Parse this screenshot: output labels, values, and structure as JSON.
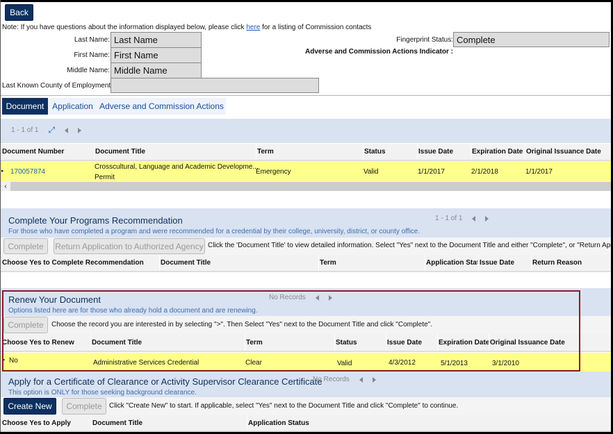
{
  "back_label": "Back",
  "note": {
    "prefix": "Note: If you have questions about the information displayed below, please click ",
    "link": "here",
    "suffix": " for a listing of Commission contacts"
  },
  "fields": {
    "last_name": {
      "label": "Last Name:",
      "value": "Last Name"
    },
    "first_name": {
      "label": "First Name:",
      "value": "First Name"
    },
    "middle_name": {
      "label": "Middle Name:",
      "value": "Middle Name"
    },
    "county": {
      "label": "Last Known County of Employment:",
      "value": ""
    },
    "fingerprint": {
      "label": "Fingerprint Status:",
      "value": "Complete"
    },
    "adverse_indicator": {
      "label": "Adverse and Commission Actions Indicator :"
    }
  },
  "tabs": [
    {
      "label": "Document",
      "active": true
    },
    {
      "label": "Application"
    },
    {
      "label": "Adverse and Commission Actions"
    }
  ],
  "documents": {
    "pager": "1 - 1 of 1",
    "columns": [
      "Document Number",
      "Document Title",
      "Term",
      "Status",
      "Issue Date",
      "Expiration Date",
      "Original Issuance Date"
    ],
    "rows": [
      {
        "number": "170057874",
        "title_line1": "Crosscultural, Language and Academic Developme...",
        "title_line2": "Permit",
        "term": "Emergency",
        "status": "Valid",
        "issue": "1/1/2017",
        "expiration": "2/1/2018",
        "original": "1/1/2017"
      }
    ]
  },
  "programs": {
    "title": "Complete Your Programs Recommendation",
    "subtitle": "For those who have completed a program and were recommended for a credential by their college, university, district, or county office.",
    "pager": "1 - 1 of 1",
    "complete_label": "Complete",
    "return_label": "Return Application to Authorized Agency",
    "instructions": "Click the 'Document Title' to view detailed information. Select \"Yes\" next to the Document Title and either \"Complete\", or \"Return Appl",
    "columns": [
      "Choose Yes to Complete Recommendation",
      "Document Title",
      "Term",
      "Application Statu",
      "Issue Date",
      "Return Reason"
    ]
  },
  "renew": {
    "title": "Renew Your Document",
    "subtitle": "Options listed here are for those who already hold a document and are renewing.",
    "pager": "No Records",
    "complete_label": "Complete",
    "instructions": "Choose the record you are interested in by selecting \">\". Then Select \"Yes\" next to the Document Title and click \"Complete\".",
    "columns": [
      "Choose Yes to Renew",
      "Document Title",
      "Term",
      "Status",
      "Issue Date",
      "Expiration Date",
      "Original Issuance Date"
    ],
    "rows": [
      {
        "choice": "No",
        "title": "Administrative Services Credential",
        "term": "Clear",
        "status": "Valid",
        "issue": "4/3/2012",
        "expiration": "5/1/2013",
        "original": "3/1/2010"
      }
    ]
  },
  "clearance": {
    "title": "Apply for a Certificate of Clearance or Activity Supervisor Clearance Certificate",
    "subtitle": "This option is ONLY for those seeking background clearance.",
    "pager": "No Records",
    "create_label": "Create New",
    "complete_label": "Complete",
    "instructions": "Click \"Create New\" to start. If applicable, select \"Yes\" next to the Document Title and click \"Complete\" to continue.",
    "columns": [
      "Choose Yes to Apply",
      "Document Title",
      "Application Status"
    ]
  },
  "colors": {
    "navy": "#0d3060",
    "band": "#d9e2f1",
    "highlight": "#ffff8c",
    "focus_box": "#8b1a2b"
  }
}
